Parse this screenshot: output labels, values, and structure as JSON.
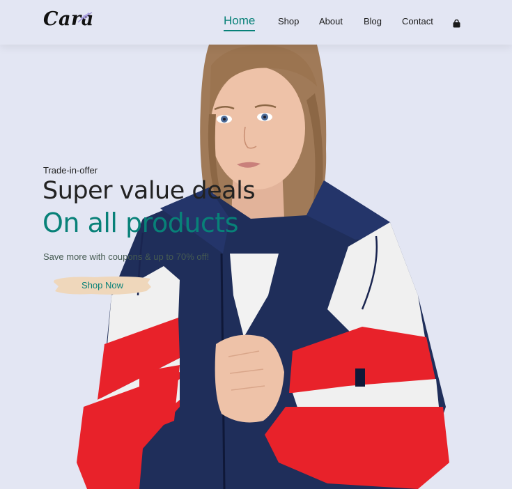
{
  "brand": {
    "name": "Cara"
  },
  "nav": {
    "items": [
      {
        "label": "Home",
        "active": true
      },
      {
        "label": "Shop"
      },
      {
        "label": "About"
      },
      {
        "label": "Blog"
      },
      {
        "label": "Contact"
      }
    ],
    "cart_icon": "shopping-bag-icon"
  },
  "hero": {
    "kicker": "Trade-in-offer",
    "heading": "Super value deals",
    "subheading": "On all products",
    "description": "Save more with coupons & up to 70% off!",
    "cta_label": "Shop Now"
  },
  "colors": {
    "background": "#e3e6f3",
    "accent": "#088178",
    "cta_brush": "#efd7bb",
    "jacket_navy": "#1f2e5a",
    "jacket_red": "#e8222a"
  }
}
